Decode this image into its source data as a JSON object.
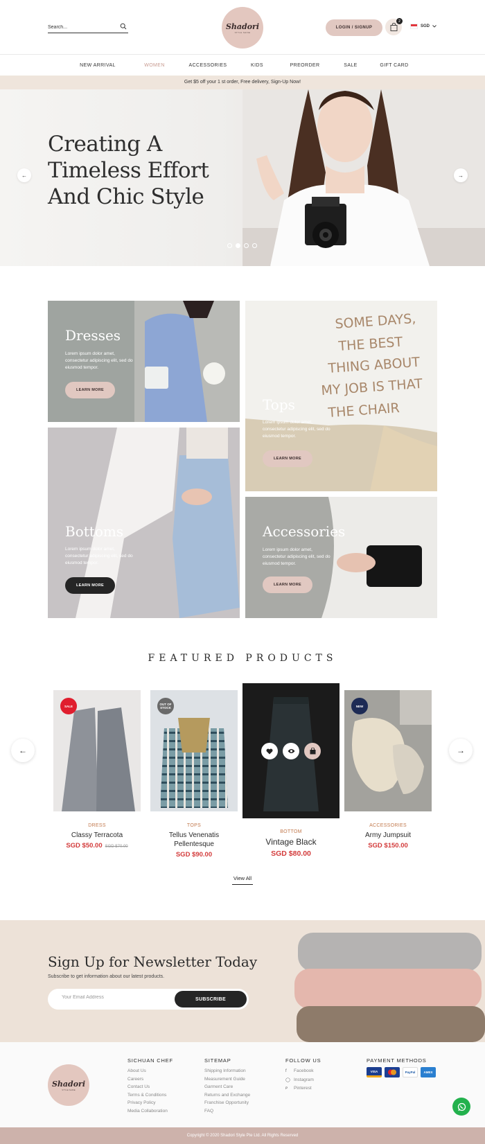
{
  "header": {
    "search_placeholder": "Search...",
    "logo_name": "Shadori",
    "logo_tag": "STYLE SHINE",
    "login_label": "LOGIN  /  SIGNUP",
    "cart_count": "2",
    "currency": "SGD"
  },
  "nav": {
    "items": [
      "NEW ARRIVAL",
      "WOMEN",
      "ACCESSORIES",
      "KIDS",
      "PREORDER",
      "SALE",
      "GIFT CARD"
    ],
    "active_index": 1
  },
  "promo": "Get $5 off your 1 st order, Free delivery, Sign-Up Now!",
  "hero": {
    "line1": "Creating A",
    "line2": "Timeless Effort",
    "line3": "And Chic Style",
    "slides": 4,
    "active_slide": 2
  },
  "categories": [
    {
      "title": "Dresses",
      "text": "Lorem ipsum dolor amet, consectetur adipiscing elit, sed do eiusmod tempor.",
      "button": "LEARN MORE"
    },
    {
      "title": "Tops",
      "text": "Lorem ipsum dolor amet, consectetur adipiscing elit, sed do eiusmod tempor.",
      "button": "LEARN MORE"
    },
    {
      "title": "Bottoms",
      "text": "Lorem ipsum dolor amet, consectetur adipiscing elit, sed do eiusmod tempor.",
      "button": "LEARN MORE"
    },
    {
      "title": "Accessories",
      "text": "Lorem ipsum dolor amet, consectetur adipiscing elit, sed do eiusmod tempor.",
      "button": "LEARN MORE"
    }
  ],
  "tops_shirt_text": [
    "SOME DAYS,",
    "THE BEST",
    "THING ABOUT",
    "MY JOB IS THAT",
    "THE CHAIR"
  ],
  "featured": {
    "title": "FEATURED PRODUCTS",
    "products": [
      {
        "category": "DRESS",
        "name": "Classy Terracota",
        "name2": "",
        "price": "SGD $50.00",
        "old_price": "SGD $70.00",
        "badge": "SALE"
      },
      {
        "category": "TOPS",
        "name": "Tellus Venenatis",
        "name2": "Pellentesque",
        "price": "SGD $90.00",
        "old_price": "",
        "badge": "OUT OF STOCK"
      },
      {
        "category": "BOTTOM",
        "name": "Vintage Black",
        "name2": "",
        "price": "SGD $80.00",
        "old_price": "",
        "badge": ""
      },
      {
        "category": "ACCESSORIES",
        "name": "Army Jumpsuit",
        "name2": "",
        "price": "SGD $150.00",
        "old_price": "",
        "badge": "NEW"
      }
    ],
    "view_all": "View All"
  },
  "newsletter": {
    "title": "Sign Up for Newsletter Today",
    "subtitle": "Subscribe to get information about our latest products.",
    "placeholder": "Your Email Address",
    "button": "SUBSCRIBE"
  },
  "footer": {
    "col1_title": "SICHUAN CHEF",
    "col1_links": [
      "About Us",
      "Careers",
      "Contact Us",
      "Terms & Conditions",
      "Privacy Policy",
      "Media Collaboration"
    ],
    "col2_title": "SITEMAP",
    "col2_links": [
      "Shipping Information",
      "Measurement Guide",
      "Garment Care",
      "Returns and Exchange",
      "Franchise Opportunity",
      "FAQ"
    ],
    "col3_title": "FOLLOW US",
    "col3_links": [
      "Facebook",
      "Instagram",
      "Pinterest"
    ],
    "col4_title": "PAYMENT METHODS",
    "payments": [
      "VISA",
      "MC",
      "PayPal",
      "AMEX"
    ]
  },
  "copyright": "Copyright © 2020 Shadori Style Pte Ltd. All Rights Reserved",
  "colors": {
    "accent": "#e1c8c1",
    "dark": "#252525",
    "price": "#d33b3b",
    "beige": "#ede2d8"
  }
}
